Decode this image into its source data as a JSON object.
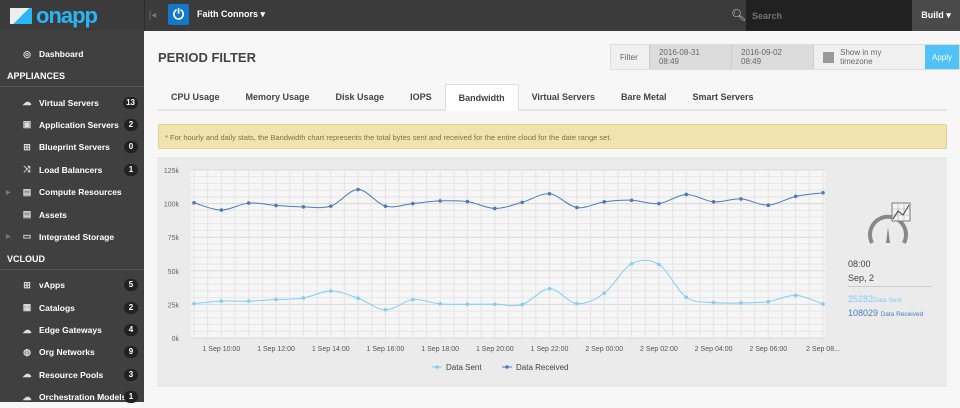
{
  "topbar": {
    "logo_text": "onapp",
    "user": "Faith Connors",
    "search_placeholder": "Search",
    "build": "Build"
  },
  "sidebar": {
    "top": [
      {
        "label": "Dashboard",
        "icon": "dashboard-icon"
      }
    ],
    "sections": [
      {
        "title": "APPLIANCES",
        "items": [
          {
            "label": "Virtual Servers",
            "badge": "13",
            "icon": "cloud-icon"
          },
          {
            "label": "Application Servers",
            "badge": "2",
            "icon": "app-server-icon"
          },
          {
            "label": "Blueprint Servers",
            "badge": "0",
            "icon": "blueprint-icon"
          },
          {
            "label": "Load Balancers",
            "badge": "1",
            "icon": "shuffle-icon"
          },
          {
            "label": "Compute Resources",
            "icon": "server-icon",
            "expandable": true
          },
          {
            "label": "Assets",
            "icon": "server-icon"
          },
          {
            "label": "Integrated Storage",
            "icon": "storage-icon",
            "expandable": true
          }
        ]
      },
      {
        "title": "VCLOUD",
        "items": [
          {
            "label": "vApps",
            "badge": "5",
            "icon": "grid-icon"
          },
          {
            "label": "Catalogs",
            "badge": "2",
            "icon": "catalog-icon"
          },
          {
            "label": "Edge Gateways",
            "badge": "4",
            "icon": "cloud-globe-icon"
          },
          {
            "label": "Org Networks",
            "badge": "9",
            "icon": "globe-icon"
          },
          {
            "label": "Resource Pools",
            "badge": "3",
            "icon": "cloud-home-icon"
          },
          {
            "label": "Orchestration Models",
            "badge": "1",
            "icon": "cloud-list-icon"
          }
        ]
      }
    ]
  },
  "main": {
    "title": "PERIOD FILTER",
    "filter": {
      "label": "Filter",
      "from": "2016-08-31 08:49",
      "to": "2016-09-02 08:49",
      "timezone_label": "Show in my timezone",
      "timezone_checked": false,
      "apply": "Apply"
    },
    "tabs": [
      {
        "label": "CPU Usage"
      },
      {
        "label": "Memory Usage"
      },
      {
        "label": "Disk Usage"
      },
      {
        "label": "IOPS"
      },
      {
        "label": "Bandwidth",
        "active": true
      },
      {
        "label": "Virtual Servers"
      },
      {
        "label": "Bare Metal"
      },
      {
        "label": "Smart Servers"
      }
    ],
    "notice": "* For hourly and daily stats, the Bandwidth chart represents the total bytes sent and received for the entire cloud for the date range set.",
    "summary": {
      "time": "08:00",
      "date": "Sep, 2",
      "sent_value": "25282",
      "sent_label": "Data Sent",
      "received_value": "108029",
      "received_label": "Data Received"
    }
  },
  "chart_data": {
    "type": "line",
    "x": [
      "1 Sep 09:00",
      "1 Sep 10:00",
      "1 Sep 11:00",
      "1 Sep 12:00",
      "1 Sep 13:00",
      "1 Sep 14:00",
      "1 Sep 15:00",
      "1 Sep 16:00",
      "1 Sep 17:00",
      "1 Sep 18:00",
      "1 Sep 19:00",
      "1 Sep 20:00",
      "1 Sep 21:00",
      "1 Sep 22:00",
      "1 Sep 23:00",
      "2 Sep 00:00",
      "2 Sep 01:00",
      "2 Sep 02:00",
      "2 Sep 03:00",
      "2 Sep 04:00",
      "2 Sep 05:00",
      "2 Sep 06:00",
      "2 Sep 07:00",
      "2 Sep 08:00"
    ],
    "xtick_labels": [
      "1 Sep 10:00",
      "1 Sep 12:00",
      "1 Sep 14:00",
      "1 Sep 16:00",
      "1 Sep 18:00",
      "1 Sep 20:00",
      "1 Sep 22:00",
      "2 Sep 00:00",
      "2 Sep 02:00",
      "2 Sep 04:00",
      "2 Sep 06:00",
      "2 Sep 08..."
    ],
    "ytick_labels": [
      "0k",
      "25k",
      "50k",
      "75k",
      "100k",
      "125k"
    ],
    "ylim": [
      0,
      125000
    ],
    "grid": true,
    "legend": "bottom",
    "series": [
      {
        "name": "Data Sent",
        "color": "#81cdf5",
        "values": [
          25600,
          27400,
          27400,
          28600,
          29800,
          35000,
          29600,
          21000,
          28600,
          25400,
          25100,
          25100,
          24900,
          36700,
          25600,
          33300,
          55200,
          54700,
          30300,
          26400,
          26100,
          27100,
          31800,
          25282
        ]
      },
      {
        "name": "Data Received",
        "color": "#4a7cb8",
        "values": [
          100600,
          95200,
          100400,
          98600,
          97600,
          98100,
          110500,
          98100,
          100000,
          102000,
          101500,
          96400,
          100900,
          107300,
          97100,
          101300,
          102500,
          100000,
          106800,
          101300,
          103500,
          98800,
          105400,
          108029
        ]
      }
    ]
  }
}
